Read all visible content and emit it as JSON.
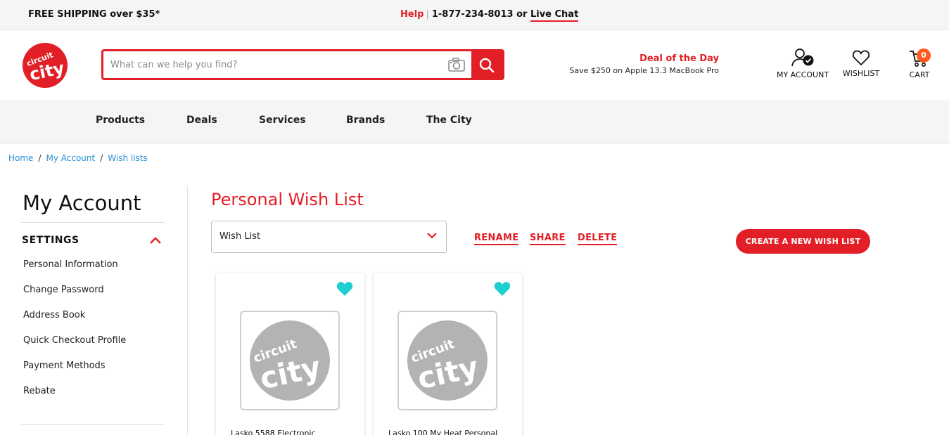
{
  "topbar": {
    "shipping": "FREE SHIPPING over $35*",
    "help": "Help",
    "separator": "|",
    "phone": "1-877-234-8013 or",
    "live_chat": "Live Chat"
  },
  "header": {
    "search_placeholder": "What can we help you find?",
    "deal_title": "Deal of the Day",
    "deal_subtitle": "Save $250 on Apple 13.3 MacBook Pro",
    "account_label": "MY ACCOUNT",
    "wishlist_label": "WISHLIST",
    "cart_label": "CART",
    "cart_count": "0"
  },
  "nav": {
    "items": [
      "Products",
      "Deals",
      "Services",
      "Brands",
      "The City"
    ]
  },
  "breadcrumb": {
    "items": [
      "Home",
      "My Account",
      "Wish lists"
    ],
    "separator": "/"
  },
  "sidebar": {
    "title": "My Account",
    "section": "SETTINGS",
    "links": [
      "Personal Information",
      "Change Password",
      "Address Book",
      "Quick Checkout Profile",
      "Payment Methods",
      "Rebate"
    ]
  },
  "main": {
    "title": "Personal Wish List",
    "selected_list": "Wish List",
    "actions": [
      "RENAME",
      "SHARE",
      "DELETE"
    ],
    "create_button": "CREATE A NEW WISH LIST",
    "products": [
      {
        "name": "Lasko 5588 Electronic"
      },
      {
        "name": "Lasko 100 My Heat Personal"
      }
    ]
  },
  "colors": {
    "brand_red": "#e21f26",
    "link_blue": "#2a8fd6",
    "heart_teal": "#1fcfcf",
    "cart_badge": "#ff5a1f"
  },
  "icons": [
    "circuit-city-logo",
    "camera-icon",
    "search-icon",
    "account-check-icon",
    "heart-icon",
    "cart-icon",
    "chevron-up-icon",
    "chevron-down-icon"
  ]
}
